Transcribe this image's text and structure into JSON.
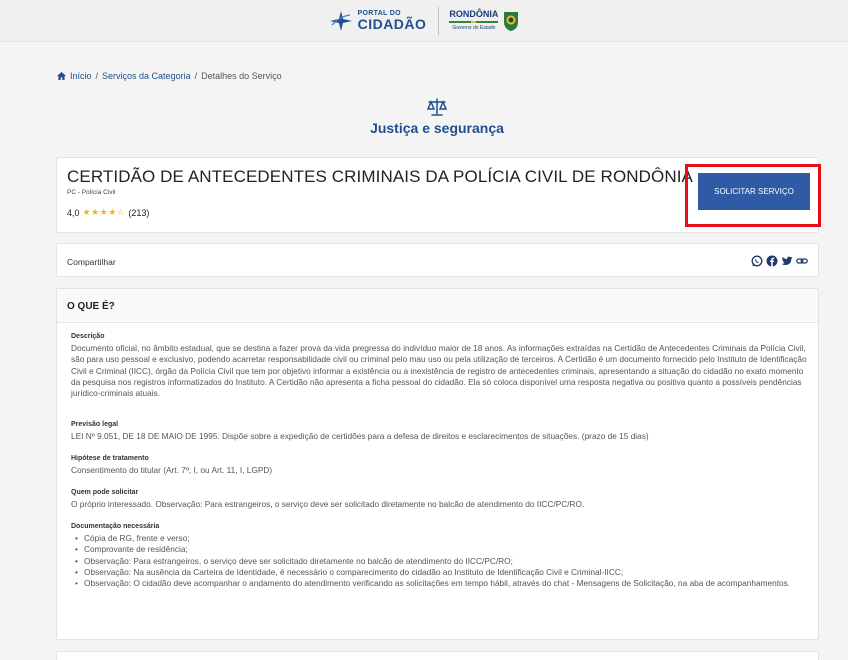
{
  "header": {
    "portal_small": "PORTAL DO",
    "portal_big": "CIDADÃO",
    "state_name": "RONDÔNIA",
    "state_sub": "Governo do Estado"
  },
  "breadcrumb": {
    "home": "Início",
    "sep1": "/",
    "category": "Serviços da Categoria",
    "sep2": "/",
    "current": "Detalhes do Serviço"
  },
  "category": {
    "icon": "scales-icon",
    "title": "Justiça e segurança"
  },
  "service": {
    "title": "CERTIDÃO DE ANTECEDENTES CRIMINAIS DA POLÍCIA CIVIL DE RONDÔNIA",
    "org": "PC - Polícia Civil",
    "rating_value": "4,0",
    "rating_stars": 4,
    "stars_display": "★★★★☆",
    "rating_count": "(213)",
    "solicitar_label": "SOLICITAR SERVIÇO"
  },
  "share": {
    "label": "Compartilhar",
    "icons": [
      "whatsapp-icon",
      "facebook-icon",
      "twitter-icon",
      "link-icon"
    ]
  },
  "oque": {
    "title": "O QUE É?",
    "descricao_label": "Descrição",
    "descricao_text": "Documento oficial, no âmbito estadual, que se destina a fazer prova da vida pregressa do indivíduo maior de 18 anos. As informações extraídas na Certidão de Antecedentes Criminais da Polícia Civil, são para uso pessoal e exclusivo, podendo acarretar responsabilidade civil ou criminal pelo mau uso ou pela utilização de terceiros. A Certidão é um documento fornecido pelo Instituto de Identificação Civil e Criminal (IICC), órgão da Polícia Civil que tem por objetivo informar a existência ou a inexistência de registro de antecedentes criminais, apresentando a situação do cidadão no exato momento da pesquisa nos registros informatizados do Instituto. A Certidão não apresenta a ficha pessoal do cidadão. Ela só coloca disponível uma resposta negativa ou positiva quanto a possíveis pendências jurídico-criminais atuais.",
    "previsao_label": "Previsão legal",
    "previsao_text": "LEI Nº 9.051, DE 18 DE MAIO DE 1995. Dispõe sobre a expedição de certidões para a defesa de direitos e esclarecimentos de situações. (prazo de 15 dias)",
    "hipotese_label": "Hipótese de tratamento",
    "hipotese_text": "Consentimento do titular (Art. 7º, I, ou Art. 11, I, LGPD)",
    "quem_label": "Quem pode solicitar",
    "quem_text": "O próprio interessado. Observação: Para estrangeiros, o serviço deve ser solicitado diretamente no balcão de atendimento do IICC/PC/RO.",
    "doc_label": "Documentação necessária",
    "doc_items": [
      "Cópia de RG, frente e verso;",
      "Comprovante de residência;",
      "Observação: Para estrangeiros, o serviço deve ser solicitado diretamente no balcão de atendimento do IICC/PC/RO;",
      "Observação: Na ausência da Carteira de Identidade, é necessário o comparecimento do cidadão ao Instituto de Identificação Civil e Criminal-IICC;",
      "Observação: O cidadão deve acompanhar o andamento do atendimento verificando as solicitações em tempo hábil, através do chat - Mensagens de Solicitação, na aba de acompanhamentos."
    ]
  },
  "colors": {
    "brand_blue": "#1f4f8f",
    "button_blue": "#2f5aa5",
    "star": "#f2b31a",
    "highlight_red": "#e3101a"
  }
}
